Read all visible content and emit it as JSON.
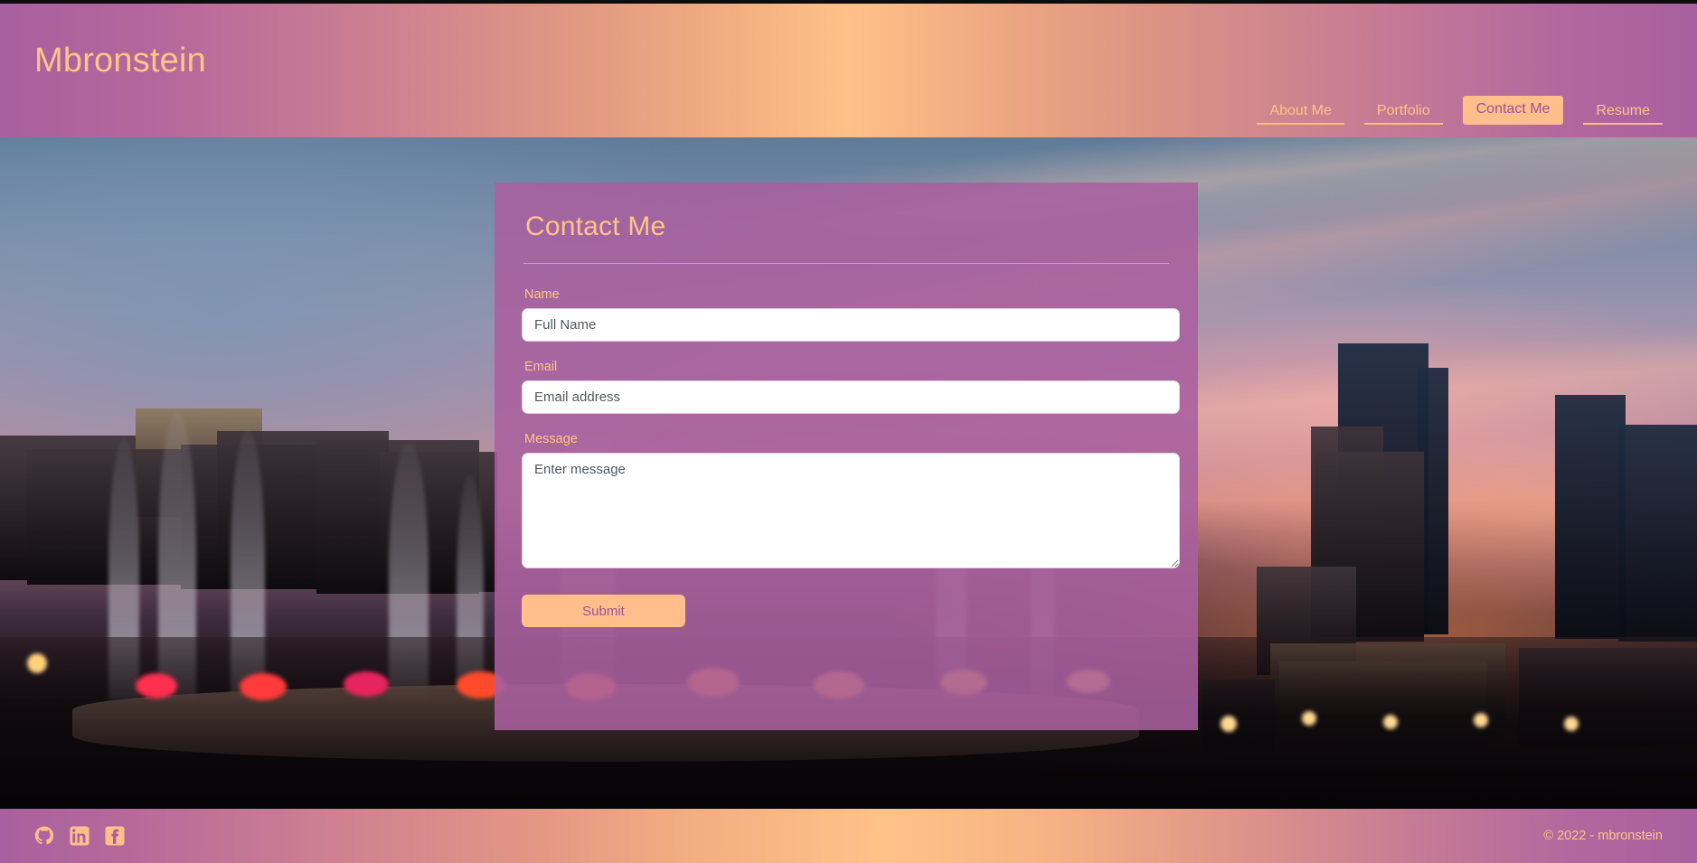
{
  "site": {
    "brand": "Mbronstein",
    "accent_peach": "#ffc488",
    "accent_purple": "#a8609e",
    "active_nav_bg": "#ffbe8c",
    "active_nav_text": "#9b5494"
  },
  "nav": {
    "items": [
      {
        "label": "About Me",
        "active": false
      },
      {
        "label": "Portfolio",
        "active": false
      },
      {
        "label": "Contact Me",
        "active": true
      },
      {
        "label": "Resume",
        "active": false
      }
    ]
  },
  "contact_card": {
    "title": "Contact Me",
    "fields": {
      "name": {
        "label": "Name",
        "placeholder": "Full Name",
        "value": ""
      },
      "email": {
        "label": "Email",
        "placeholder": "Email address",
        "value": ""
      },
      "message": {
        "label": "Message",
        "placeholder": "Enter message",
        "value": ""
      }
    },
    "submit_label": "Submit"
  },
  "footer": {
    "social": [
      {
        "name": "github-icon",
        "label": "GitHub"
      },
      {
        "name": "linkedin-icon",
        "label": "LinkedIn"
      },
      {
        "name": "facebook-icon",
        "label": "Facebook"
      }
    ],
    "copyright": "© 2022 - mbronstein"
  },
  "background": {
    "description": "Chicago Buckingham Fountain at dusk with downtown skyline and sunset sky"
  }
}
